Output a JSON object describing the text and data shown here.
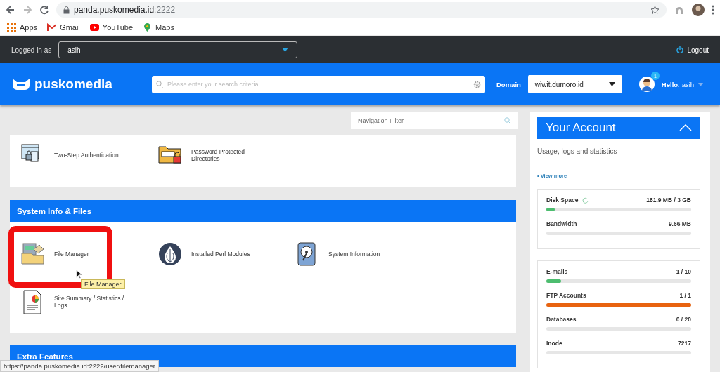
{
  "browser": {
    "url_host": "panda.puskomedia.id",
    "url_port": ":2222",
    "bookmarks": [
      {
        "label": "Apps",
        "kind": "apps"
      },
      {
        "label": "Gmail",
        "kind": "gmail"
      },
      {
        "label": "YouTube",
        "kind": "youtube"
      },
      {
        "label": "Maps",
        "kind": "maps"
      }
    ]
  },
  "topbar": {
    "label": "Logged in as",
    "user": "asih",
    "logout": "Logout"
  },
  "header": {
    "brand": "puskomedia",
    "search_placeholder": "Please enter your search criteria",
    "domain_label": "Domain",
    "domain": "wiwit.dumoro.id",
    "notification_count": "1",
    "greeting": "Hello,",
    "user": "asih"
  },
  "nav_filter": {
    "placeholder": "Navigation Filter"
  },
  "sections": [
    {
      "items": [
        {
          "label": "Two-Step Authentication",
          "kind": "two-step",
          "highlighted": false
        },
        {
          "label": "Password Protected Directories",
          "kind": "folder-lock",
          "highlighted": false
        }
      ]
    },
    {
      "title": "System Info & Files",
      "items": [
        {
          "label": "File Manager",
          "kind": "file-manager",
          "highlighted": true,
          "tooltip": "File Manager"
        },
        {
          "label": "Installed Perl Modules",
          "kind": "perl",
          "highlighted": false
        },
        {
          "label": "System Information",
          "kind": "disk",
          "highlighted": false
        },
        {
          "label": "Site Summary / Statistics / Logs",
          "kind": "report",
          "highlighted": false
        }
      ]
    },
    {
      "title": "Extra Features"
    }
  ],
  "account": {
    "title": "Your Account",
    "expanded": true,
    "subtitle": "Usage, logs and statistics",
    "link": "• View more",
    "groups": [
      {
        "stats": [
          {
            "label": "Disk Space",
            "value": "181.9 MB / 3 GB",
            "level": 0.06,
            "refresh": true
          },
          {
            "label": "Bandwidth",
            "value": "9.66 MB",
            "level": 0,
            "refresh": false
          }
        ]
      },
      {
        "stats": [
          {
            "label": "E-mails",
            "value": "1 / 10",
            "level": 0.1,
            "refresh": false
          },
          {
            "label": "FTP Accounts",
            "value": "1 / 1",
            "level": 1,
            "refresh": false
          },
          {
            "label": "Databases",
            "value": "0 / 20",
            "level": 0,
            "refresh": false
          },
          {
            "label": "Inode",
            "value": "7217",
            "level": 0,
            "refresh": false
          }
        ]
      }
    ]
  },
  "status_url": "https://panda.puskomedia.id:2222/user/filemanager"
}
